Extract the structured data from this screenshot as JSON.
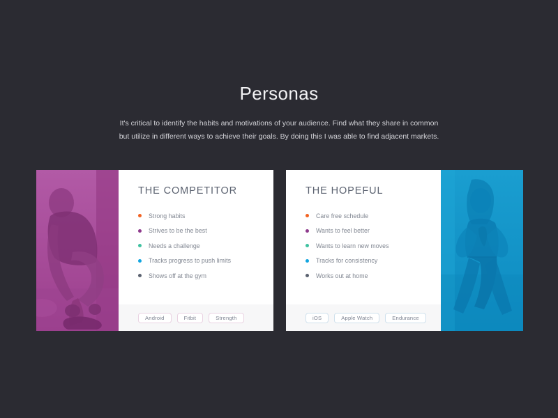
{
  "header": {
    "title": "Personas",
    "description": "It's critical to identify the habits and motivations of your audience. Find what they share in common but utilize in different ways to achieve their goals. By doing this I was able to find adjacent markets."
  },
  "theme": {
    "background": "#2b2b32",
    "card_background": "#ffffff",
    "footer_background": "#f7f7f8",
    "title_color": "#f2f2f4",
    "description_color": "#d3d3d8",
    "card_title_color": "#5b6270",
    "trait_color": "#808691"
  },
  "bullet_colors": [
    "#f26322",
    "#8e3a8c",
    "#3fc1a0",
    "#12a5e0",
    "#5b6270"
  ],
  "cards": [
    {
      "id": "competitor",
      "title": "THE COMPETITOR",
      "image_side": "left",
      "image_name": "athlete-tying-shoe-photo",
      "image_tint": "#a84a98",
      "pill_style": "pink",
      "traits": [
        "Strong habits",
        "Strives to be the best",
        "Needs a challenge",
        "Tracks progress to push limits",
        "Shows off at the gym"
      ],
      "tags": [
        "Android",
        "Fitbit",
        "Strength"
      ]
    },
    {
      "id": "hopeful",
      "title": "THE HOPEFUL",
      "image_side": "right",
      "image_name": "woman-yoga-pose-photo",
      "image_tint": "#0f93c8",
      "pill_style": "blue",
      "traits": [
        "Care free schedule",
        "Wants to feel better",
        "Wants to learn new moves",
        "Tracks for consistency",
        "Works out at home"
      ],
      "tags": [
        "iOS",
        "Apple Watch",
        "Endurance"
      ]
    }
  ]
}
